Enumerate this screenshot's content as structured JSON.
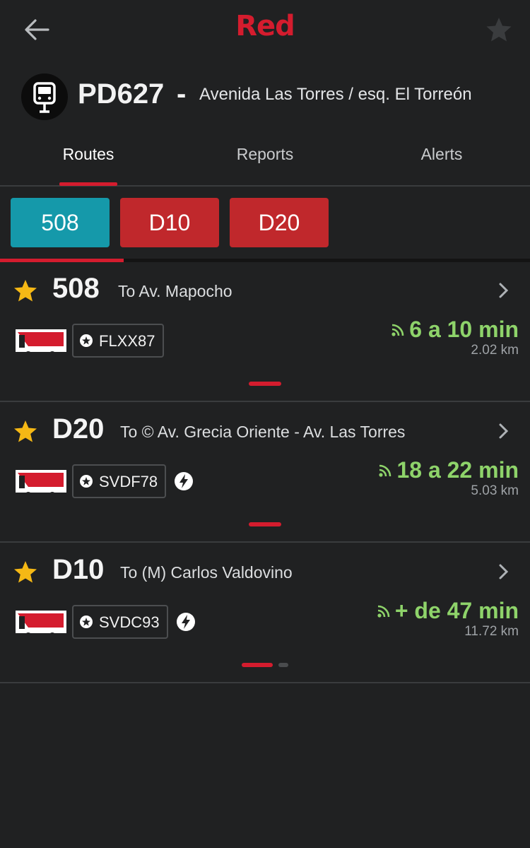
{
  "app": {
    "logo": "Red"
  },
  "stop": {
    "code": "PD627",
    "dash": "-",
    "name": "Avenida Las Torres / esq. El Torreón"
  },
  "tabs": [
    {
      "label": "Routes",
      "active": true
    },
    {
      "label": "Reports",
      "active": false
    },
    {
      "label": "Alerts",
      "active": false
    }
  ],
  "route_chips": [
    {
      "label": "508",
      "color": "#1599aa",
      "selected": true
    },
    {
      "label": "D10",
      "color": "#c0282c",
      "selected": false
    },
    {
      "label": "D20",
      "color": "#c0282c",
      "selected": false
    }
  ],
  "colors": {
    "accent": "#d41c2e",
    "eta_green": "#8ed36a",
    "star": "#f5b815"
  },
  "arrivals": [
    {
      "route": "508",
      "destination": "To Av. Mapocho",
      "plate": "FLXX87",
      "electric": false,
      "eta": "6 a 10 min",
      "distance": "2.02 km",
      "favorite": true
    },
    {
      "route": "D20",
      "destination": "To © Av. Grecia Oriente - Av. Las Torres",
      "plate": "SVDF78",
      "electric": true,
      "eta": "18 a 22 min",
      "distance": "5.03 km",
      "favorite": true
    },
    {
      "route": "D10",
      "destination": "To (M) Carlos Valdovino",
      "plate": "SVDC93",
      "electric": true,
      "eta": "+ de 47 min",
      "distance": "11.72 km",
      "favorite": true
    }
  ],
  "icons": {
    "back": "arrow-left-icon",
    "favorite": "star-outline-icon",
    "stop": "bus-stop-icon",
    "route_star": "star-icon",
    "chevron": "chevron-right-icon",
    "bus": "bus-icon",
    "plate": "plate-badge-icon",
    "electric": "electric-bolt-icon",
    "realtime": "rss-signal-icon"
  }
}
